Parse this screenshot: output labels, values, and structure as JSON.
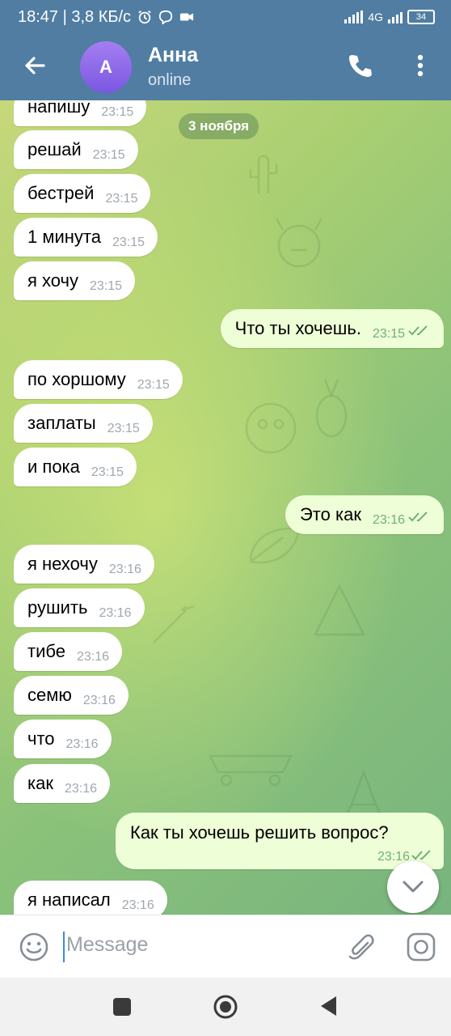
{
  "status_bar": {
    "time_speed": "18:47 | 3,8 КБ/с",
    "network": "4G",
    "battery": "34"
  },
  "header": {
    "avatar_letter": "A",
    "title": "Анна",
    "subtitle": "online"
  },
  "chat": {
    "date": "3 ноября",
    "messages": [
      {
        "dir": "in",
        "text": "напишу",
        "time": "23:15"
      },
      {
        "dir": "in",
        "text": "решай",
        "time": "23:15"
      },
      {
        "dir": "in",
        "text": "бестрей",
        "time": "23:15"
      },
      {
        "dir": "in",
        "text": "1 минута",
        "time": "23:15"
      },
      {
        "dir": "in",
        "text": "я хочу",
        "time": "23:15"
      },
      {
        "dir": "out",
        "text": "Что ты хочешь.",
        "time": "23:15"
      },
      {
        "dir": "in",
        "text": "по хоршому",
        "time": "23:15"
      },
      {
        "dir": "in",
        "text": "заплаты",
        "time": "23:15"
      },
      {
        "dir": "in",
        "text": "и пока",
        "time": "23:15"
      },
      {
        "dir": "out",
        "text": "Это как",
        "time": "23:16"
      },
      {
        "dir": "in",
        "text": "я нехочу",
        "time": "23:16"
      },
      {
        "dir": "in",
        "text": "рушить",
        "time": "23:16"
      },
      {
        "dir": "in",
        "text": "тибе",
        "time": "23:16"
      },
      {
        "dir": "in",
        "text": "семю",
        "time": "23:16"
      },
      {
        "dir": "in",
        "text": "что",
        "time": "23:16"
      },
      {
        "dir": "in",
        "text": "как",
        "time": "23:16"
      },
      {
        "dir": "out",
        "text": "Как ты хочешь решить вопрос?",
        "time": "23:16"
      },
      {
        "dir": "in",
        "text": "я написал",
        "time": "23:16"
      }
    ]
  },
  "input": {
    "placeholder": "Message"
  },
  "icons": {
    "back": "arrow-left-icon",
    "call": "phone-icon",
    "menu": "more-vert-icon",
    "emoji": "emoji-icon",
    "attach": "paperclip-icon",
    "camera": "camera-icon",
    "scroll": "chevron-down-icon"
  },
  "colors": {
    "header": "#517da2",
    "incoming_bubble": "#ffffff",
    "outgoing_bubble": "#eefed6",
    "read_ticks": "#6fb17a"
  }
}
